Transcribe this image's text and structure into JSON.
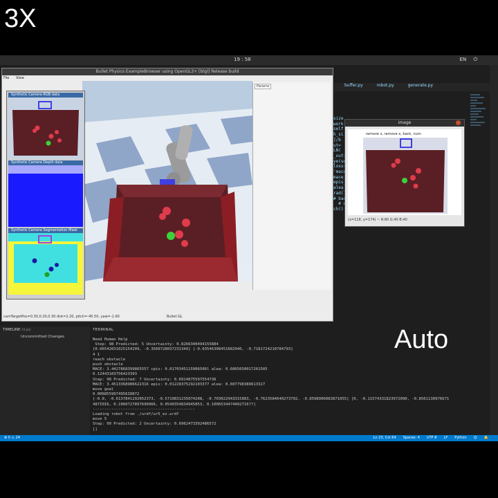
{
  "overlay": {
    "speed_label": "3X",
    "mode_label": "Auto"
  },
  "topbar": {
    "clock": "19 : 58",
    "tray": [
      "EN",
      "⏻"
    ]
  },
  "bullet_window": {
    "title": "Bullet Physics ExampleBrowser using OpenGL3+ [btgl] Release build",
    "menu": [
      "File",
      "View"
    ],
    "params_label": "Params",
    "status": "camTargetPos=0.30,0.20,0.30  dist=2.20, pitch=-45.50, yaw=-1.60",
    "status_right": "Bullet GL",
    "cam_headers": [
      "Synthetic Camera RGB data",
      "Synthetic Camera Depth data",
      "Synthetic Camera Segmentation Mask"
    ]
  },
  "image_window": {
    "title": "image",
    "caption": "remove x, remove x, back, num",
    "status": "(x=118, y=174) ~ R:80 G:40 B:40"
  },
  "editor": {
    "tabs": [
      "buffer.py",
      "robot.py",
      "generate.py"
    ],
    "code_lines": [
      "size",
      "",
      "work",
      "",
      "self.",
      "",
      "",
      "h_si",
      "]/b",
      "",
      "",
      "",
      "",
      "",
      "",
      "",
      "",
      "ut=",
      "LN(",
      "_out['pi'],mle_out['mu'],mle_out['sigma']",
      "ye(self.action_size)[batch_out].to(device",
      "loss(pi,mu,sigma,target)",
      "'mace_avg'] - self.ratio*loss_out['epis_avg'] + se",
      "mace_avg'].cpu().item()",
      "epis_avg'].cpu().item()",
      "alea_avg'].cpu().item()",
      "rad() # reset gradient",
      "# back-propagation",
      "  # optimizer update",
      "ch()"
    ]
  },
  "panel": {
    "timeline_label": "TIMELINE",
    "timeline_file": "nl.py",
    "uncommitted": "Uncommitted Changes",
    "terminal_tab": "TERMINAL",
    "terminal_lines": [
      "Need Human Help",
      " Step: 98 Predicted: 5 Uncertainty: 0.8266340494155884",
      "[0.06542031025154209, -0.3560728037231349] [-0.03546308451682940, -0.7181724210784793]",
      "4 1",
      "reach obstacle",
      "push obstacle",
      "MACE: 3.4427868399865557 cpis: 0.0170345115906506l alea: 0.6065650017261505",
      "0.12443103756423393",
      "Step: 98 Predicted: 7 Uncertainty: 0.6914875597554736",
      "MACE: 3.4513368986622316 epis: 0.01228375292103377 alea: 0.607798389613327",
      "move goal",
      "0.0068559974956I8872",
      "[-0.0, -0.6137841292052373, -0.5710831235074208, -0.703022943315883, -0.7623584640273702, -0.8598906083871055] [0, -0.11574331823972090, -0.8561130976671",
      "487I0I6, 0.1060727897696066, 0.0540354834945853, 0.1006534474402716??]",
      "--------------------------------------------",
      "Loading robot from ./urdf/ur5_ez.urdf",
      "move 5",
      "Step: 99 Predicted: 2 Uncertainty: 0.6962473392486572",
      "[]"
    ]
  },
  "statusbar": {
    "left": "⊗ 0  ⚠ 24",
    "right": [
      "Ln 23, Col 64",
      "Spaces: 4",
      "UTF-8",
      "LF",
      "Python",
      "☺",
      "🔔"
    ]
  },
  "colors": {
    "vscode_blue": "#007acc",
    "tray_red": "#8b1e24",
    "sky": "#b7c9dd"
  }
}
